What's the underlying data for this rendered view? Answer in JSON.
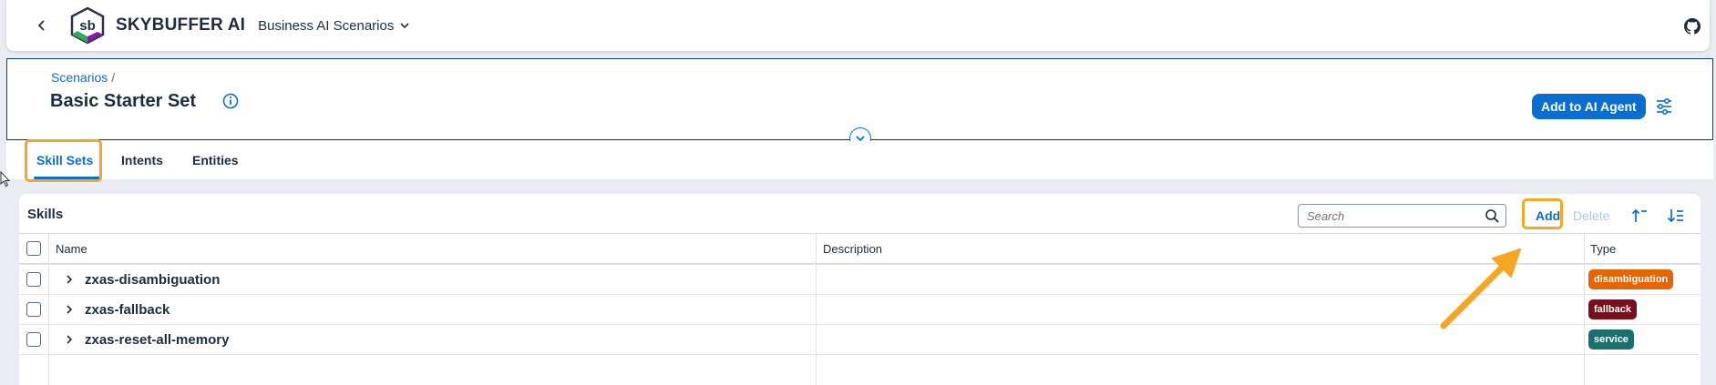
{
  "shell": {
    "brand": "SKYBUFFER AI",
    "product": "Business AI Scenarios",
    "logo_text": "sb"
  },
  "header": {
    "breadcrumb": "Scenarios",
    "breadcrumb_sep": "/",
    "title": "Basic Starter Set",
    "add_to_agent": "Add to AI Agent"
  },
  "tabs": [
    {
      "label": "Skill Sets",
      "active": true
    },
    {
      "label": "Intents",
      "active": false
    },
    {
      "label": "Entities",
      "active": false
    }
  ],
  "skills": {
    "title": "Skills",
    "search_placeholder": "Search",
    "add_label": "Add",
    "delete_label": "Delete",
    "columns": {
      "name": "Name",
      "description": "Description",
      "type": "Type"
    },
    "rows": [
      {
        "name": "zxas-disambiguation",
        "description": "",
        "type": "disambiguation",
        "type_color": "#e76500"
      },
      {
        "name": "zxas-fallback",
        "description": "",
        "type": "fallback",
        "type_color": "#7a0e1a"
      },
      {
        "name": "zxas-reset-all-memory",
        "description": "",
        "type": "service",
        "type_color": "#1a6f6f"
      }
    ]
  },
  "colors": {
    "accent": "#0a6ed1",
    "highlight": "#f5a623",
    "header_border": "#0a3d8f"
  }
}
